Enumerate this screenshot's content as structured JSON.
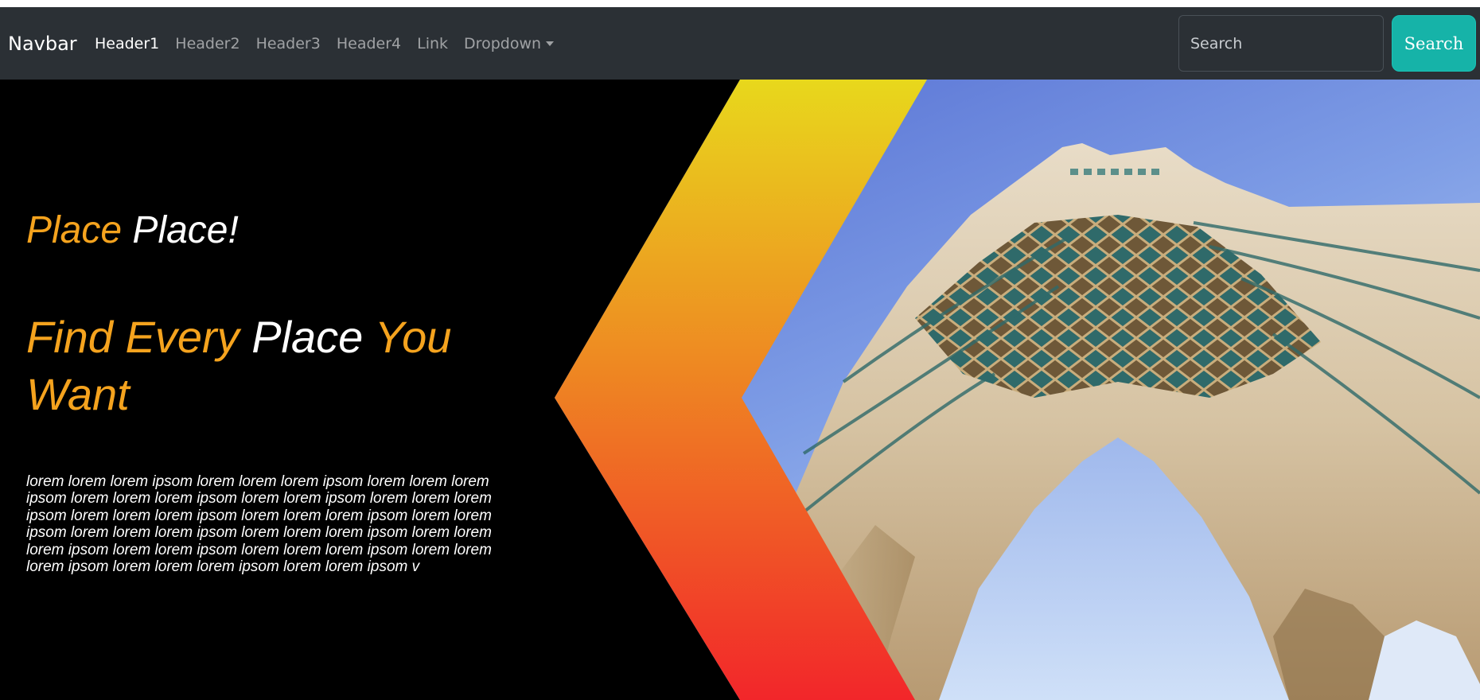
{
  "navbar": {
    "brand": "Navbar",
    "links": [
      {
        "label": "Header1",
        "active": true
      },
      {
        "label": "Header2"
      },
      {
        "label": "Header3"
      },
      {
        "label": "Header4"
      },
      {
        "label": "Link"
      },
      {
        "label": "Dropdown",
        "has_caret": true
      }
    ],
    "search": {
      "placeholder": "Search",
      "value": "",
      "button_label": "Search"
    }
  },
  "hero": {
    "tagline": {
      "part1": "Place",
      "part2": "Place!"
    },
    "headline": {
      "part1": "Find Every",
      "part2": "Place",
      "part3": "You Want"
    },
    "body": "lorem lorem lorem ipsom lorem lorem lorem ipsom lorem lorem lorem ipsom lorem lorem lorem ipsom lorem lorem ipsom lorem lorem lorem ipsom lorem lorem lorem ipsom lorem lorem lorem ipsom lorem lorem ipsom lorem lorem lorem ipsom lorem lorem lorem ipsom lorem lorem lorem ipsom lorem lorem ipsom lorem lorem lorem ipsom lorem lorem lorem ipsom lorem lorem lorem ipsom lorem lorem ipsom v",
    "image": "azadi-tower-photo"
  },
  "colors": {
    "navbar_bg": "#2b3035",
    "accent_orange": "#f5a31e",
    "search_button": "#16b3a8",
    "gradient_top": "#e8d81c",
    "gradient_bottom": "#f2262a"
  }
}
